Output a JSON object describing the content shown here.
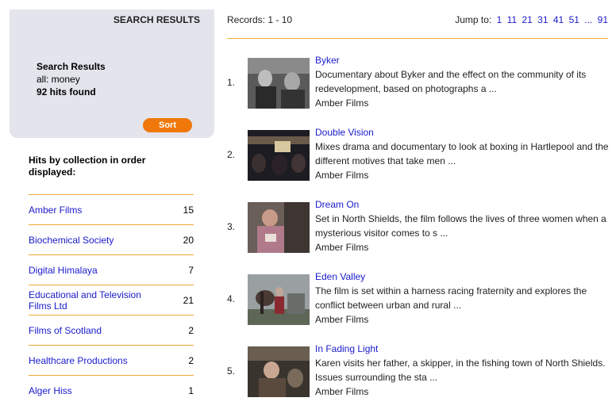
{
  "left": {
    "header": "SEARCH RESULTS",
    "title": "Search Results",
    "query": "all: money",
    "hits": "92 hits found",
    "sort_label": "Sort",
    "collections_title": "Hits by collection in order displayed:",
    "collections": [
      {
        "name": "Amber Films",
        "count": "15"
      },
      {
        "name": "Biochemical Society",
        "count": "20"
      },
      {
        "name": "Digital Himalaya",
        "count": "7"
      },
      {
        "name": "Educational and Television Films Ltd",
        "count": "21"
      },
      {
        "name": "Films of Scotland",
        "count": "2"
      },
      {
        "name": "Healthcare Productions",
        "count": "2"
      },
      {
        "name": "Alger Hiss",
        "count": "1"
      }
    ]
  },
  "right": {
    "records": "Records: 1 - 10",
    "jump_label": "Jump to:",
    "jump_links": [
      "1",
      "11",
      "21",
      "31",
      "41",
      "51",
      "...",
      "91"
    ],
    "results": [
      {
        "num": "1.",
        "title": "Byker",
        "desc": "Documentary about Byker and the effect on the community of its redevelopment, based on photographs a ...",
        "source": "Amber Films"
      },
      {
        "num": "2.",
        "title": "Double Vision",
        "desc": "Mixes drama and documentary to look at boxing in Hartlepool and the different motives that take men ...",
        "source": "Amber Films"
      },
      {
        "num": "3.",
        "title": "Dream On",
        "desc": "Set in North Shields, the film follows the lives of three women when a mysterious visitor comes to s ...",
        "source": "Amber Films"
      },
      {
        "num": "4.",
        "title": "Eden Valley",
        "desc": "The film is set within a harness racing fraternity and explores the conflict between urban and rural ...",
        "source": "Amber Films"
      },
      {
        "num": "5.",
        "title": "In Fading Light",
        "desc": "Karen visits her father, a skipper, in the fishing town of North Shields. Issues surrounding the sta ...",
        "source": "Amber Films"
      }
    ]
  }
}
